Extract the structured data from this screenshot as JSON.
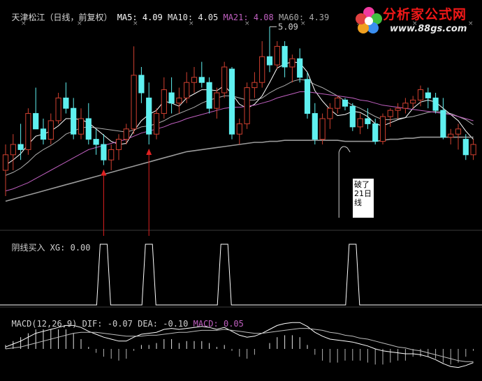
{
  "header": {
    "stock": "天津松江（日线，前复权）",
    "ma5_label": "MA5:",
    "ma5_value": "4.09",
    "ma10_label": "MA10:",
    "ma10_value": "4.05",
    "ma21_label": "MA21:",
    "ma21_value": "4.08",
    "ma60_label": "MA60:",
    "ma60_value": "4.39"
  },
  "indicator": {
    "label": "阴线买入 XG:",
    "value": "0.00"
  },
  "macd": {
    "label": "MACD(12,26,9)",
    "dif_label": "DIF:",
    "dif_value": "-0.07",
    "dea_label": "DEA:",
    "dea_value": "-0.10",
    "macd_label": "MACD:",
    "macd_value": "0.05"
  },
  "annotation": {
    "text": "破了21日线"
  },
  "watermark": {
    "title": "分析家公式网",
    "url": "www.88gs.com"
  },
  "colors": {
    "candle_up": "#d04030",
    "candle_down": "#5ff0f0",
    "ma5": "#ffffff",
    "ma10": "#e8e8e8",
    "ma21": "#c060c0",
    "ma60": "#9a9a9a",
    "xg": "#ffffff",
    "macd_pos": "#ffffff",
    "macd_neg": "#ffffff",
    "arrow": "#e02020"
  },
  "chart_data": [
    {
      "type": "candlestick",
      "title": "天津松江（日线，前复权）",
      "y_range": [
        3.2,
        5.2
      ],
      "max_label": "5.09",
      "candles": [
        {
          "o": 3.7,
          "h": 3.95,
          "l": 3.45,
          "c": 3.85
        },
        {
          "o": 3.85,
          "h": 4.05,
          "l": 3.7,
          "c": 3.95
        },
        {
          "o": 3.95,
          "h": 4.15,
          "l": 3.8,
          "c": 3.9
        },
        {
          "o": 3.9,
          "h": 4.3,
          "l": 3.85,
          "c": 4.25
        },
        {
          "o": 4.25,
          "h": 4.5,
          "l": 4.1,
          "c": 4.1
        },
        {
          "o": 4.1,
          "h": 4.2,
          "l": 3.95,
          "c": 4.0
        },
        {
          "o": 4.0,
          "h": 4.25,
          "l": 3.95,
          "c": 4.18
        },
        {
          "o": 4.18,
          "h": 4.45,
          "l": 4.15,
          "c": 4.4
        },
        {
          "o": 4.4,
          "h": 4.55,
          "l": 4.25,
          "c": 4.3
        },
        {
          "o": 4.3,
          "h": 4.4,
          "l": 4.0,
          "c": 4.05
        },
        {
          "o": 4.05,
          "h": 4.3,
          "l": 4.0,
          "c": 4.2
        },
        {
          "o": 4.2,
          "h": 4.35,
          "l": 3.95,
          "c": 4.0
        },
        {
          "o": 4.0,
          "h": 4.1,
          "l": 3.85,
          "c": 3.95
        },
        {
          "o": 3.95,
          "h": 4.05,
          "l": 3.75,
          "c": 3.8
        },
        {
          "o": 3.8,
          "h": 3.95,
          "l": 3.7,
          "c": 3.9
        },
        {
          "o": 3.9,
          "h": 4.05,
          "l": 3.8,
          "c": 4.0
        },
        {
          "o": 4.0,
          "h": 4.15,
          "l": 3.95,
          "c": 4.1
        },
        {
          "o": 4.1,
          "h": 4.9,
          "l": 4.05,
          "c": 4.62
        },
        {
          "o": 4.62,
          "h": 4.7,
          "l": 4.35,
          "c": 4.45
        },
        {
          "o": 4.4,
          "h": 4.55,
          "l": 3.95,
          "c": 4.05
        },
        {
          "o": 4.05,
          "h": 4.3,
          "l": 4.0,
          "c": 4.25
        },
        {
          "o": 4.25,
          "h": 4.6,
          "l": 4.2,
          "c": 4.48
        },
        {
          "o": 4.45,
          "h": 4.6,
          "l": 4.25,
          "c": 4.35
        },
        {
          "o": 4.35,
          "h": 4.5,
          "l": 4.25,
          "c": 4.4
        },
        {
          "o": 4.4,
          "h": 4.65,
          "l": 4.35,
          "c": 4.55
        },
        {
          "o": 4.55,
          "h": 4.7,
          "l": 4.45,
          "c": 4.6
        },
        {
          "o": 4.6,
          "h": 4.75,
          "l": 4.5,
          "c": 4.55
        },
        {
          "o": 4.55,
          "h": 4.6,
          "l": 4.25,
          "c": 4.3
        },
        {
          "o": 4.3,
          "h": 4.5,
          "l": 4.2,
          "c": 4.45
        },
        {
          "o": 4.45,
          "h": 4.75,
          "l": 4.4,
          "c": 4.7
        },
        {
          "o": 4.68,
          "h": 4.7,
          "l": 4.0,
          "c": 4.05
        },
        {
          "o": 4.05,
          "h": 4.2,
          "l": 3.95,
          "c": 4.15
        },
        {
          "o": 4.15,
          "h": 4.55,
          "l": 4.1,
          "c": 4.5
        },
        {
          "o": 4.5,
          "h": 4.65,
          "l": 4.4,
          "c": 4.55
        },
        {
          "o": 4.55,
          "h": 4.95,
          "l": 4.5,
          "c": 4.8
        },
        {
          "o": 4.8,
          "h": 5.09,
          "l": 4.65,
          "c": 4.72
        },
        {
          "o": 4.72,
          "h": 4.95,
          "l": 4.68,
          "c": 4.9
        },
        {
          "o": 4.9,
          "h": 4.95,
          "l": 4.6,
          "c": 4.7
        },
        {
          "o": 4.7,
          "h": 4.82,
          "l": 4.55,
          "c": 4.78
        },
        {
          "o": 4.78,
          "h": 4.88,
          "l": 4.55,
          "c": 4.6
        },
        {
          "o": 4.58,
          "h": 4.65,
          "l": 4.2,
          "c": 4.25
        },
        {
          "o": 4.25,
          "h": 4.35,
          "l": 3.95,
          "c": 4.0
        },
        {
          "o": 4.0,
          "h": 4.25,
          "l": 3.95,
          "c": 4.2
        },
        {
          "o": 4.2,
          "h": 4.35,
          "l": 4.1,
          "c": 4.3
        },
        {
          "o": 4.3,
          "h": 4.42,
          "l": 4.25,
          "c": 4.4
        },
        {
          "o": 4.38,
          "h": 4.4,
          "l": 4.28,
          "c": 4.32
        },
        {
          "o": 4.32,
          "h": 4.35,
          "l": 4.08,
          "c": 4.12
        },
        {
          "o": 4.12,
          "h": 4.25,
          "l": 4.05,
          "c": 4.2
        },
        {
          "o": 4.2,
          "h": 4.3,
          "l": 4.1,
          "c": 4.15
        },
        {
          "o": 4.15,
          "h": 4.2,
          "l": 3.95,
          "c": 3.98
        },
        {
          "o": 3.98,
          "h": 4.25,
          "l": 3.95,
          "c": 4.22
        },
        {
          "o": 4.22,
          "h": 4.3,
          "l": 4.12,
          "c": 4.28
        },
        {
          "o": 4.28,
          "h": 4.35,
          "l": 4.2,
          "c": 4.3
        },
        {
          "o": 4.3,
          "h": 4.4,
          "l": 4.25,
          "c": 4.35
        },
        {
          "o": 4.35,
          "h": 4.42,
          "l": 4.3,
          "c": 4.38
        },
        {
          "o": 4.38,
          "h": 4.52,
          "l": 4.32,
          "c": 4.48
        },
        {
          "o": 4.45,
          "h": 4.5,
          "l": 4.3,
          "c": 4.4
        },
        {
          "o": 4.4,
          "h": 4.45,
          "l": 4.25,
          "c": 4.28
        },
        {
          "o": 4.28,
          "h": 4.4,
          "l": 4.0,
          "c": 4.02
        },
        {
          "o": 4.02,
          "h": 4.1,
          "l": 3.95,
          "c": 4.05
        },
        {
          "o": 4.05,
          "h": 4.15,
          "l": 3.9,
          "c": 4.1
        },
        {
          "o": 4.0,
          "h": 4.05,
          "l": 3.8,
          "c": 3.85
        },
        {
          "o": 3.85,
          "h": 4.0,
          "l": 3.8,
          "c": 3.95
        }
      ],
      "ma_series": [
        {
          "name": "MA5",
          "values": [
            3.75,
            3.8,
            3.86,
            3.95,
            4.03,
            4.05,
            4.08,
            4.13,
            4.2,
            4.2,
            4.19,
            4.16,
            4.1,
            4.04,
            3.98,
            3.95,
            3.96,
            4.08,
            4.18,
            4.24,
            4.28,
            4.37,
            4.35,
            4.32,
            4.4,
            4.44,
            4.48,
            4.48,
            4.47,
            4.52,
            4.44,
            4.34,
            4.3,
            4.34,
            4.42,
            4.55,
            4.69,
            4.73,
            4.75,
            4.74,
            4.65,
            4.47,
            4.37,
            4.29,
            4.23,
            4.24,
            4.27,
            4.26,
            4.22,
            4.15,
            4.13,
            4.16,
            4.19,
            4.21,
            4.3,
            4.36,
            4.38,
            4.36,
            4.3,
            4.24,
            4.18,
            4.08,
            4.0
          ]
        },
        {
          "name": "MA10",
          "values": [
            3.65,
            3.68,
            3.72,
            3.78,
            3.85,
            3.9,
            3.94,
            3.99,
            4.05,
            4.08,
            4.11,
            4.12,
            4.11,
            4.1,
            4.09,
            4.08,
            4.07,
            4.09,
            4.12,
            4.13,
            4.15,
            4.18,
            4.22,
            4.25,
            4.28,
            4.31,
            4.35,
            4.38,
            4.4,
            4.42,
            4.42,
            4.4,
            4.38,
            4.38,
            4.4,
            4.45,
            4.49,
            4.52,
            4.56,
            4.58,
            4.57,
            4.53,
            4.5,
            4.46,
            4.42,
            4.37,
            4.33,
            4.3,
            4.26,
            4.22,
            4.19,
            4.19,
            4.2,
            4.21,
            4.22,
            4.24,
            4.26,
            4.27,
            4.26,
            4.25,
            4.22,
            4.19,
            4.14
          ]
        },
        {
          "name": "MA21",
          "values": [
            3.5,
            3.52,
            3.55,
            3.58,
            3.62,
            3.66,
            3.7,
            3.74,
            3.78,
            3.82,
            3.86,
            3.9,
            3.92,
            3.94,
            3.96,
            3.98,
            4.0,
            4.03,
            4.06,
            4.08,
            4.1,
            4.12,
            4.15,
            4.17,
            4.2,
            4.22,
            4.24,
            4.26,
            4.28,
            4.3,
            4.31,
            4.31,
            4.32,
            4.33,
            4.35,
            4.37,
            4.4,
            4.42,
            4.44,
            4.46,
            4.46,
            4.45,
            4.44,
            4.43,
            4.42,
            4.41,
            4.4,
            4.38,
            4.37,
            4.35,
            4.33,
            4.32,
            4.31,
            4.3,
            4.29,
            4.28,
            4.27,
            4.26,
            4.25,
            4.24,
            4.22,
            4.2,
            4.18
          ]
        },
        {
          "name": "MA60",
          "values": [
            3.4,
            3.42,
            3.44,
            3.46,
            3.48,
            3.5,
            3.52,
            3.54,
            3.56,
            3.58,
            3.6,
            3.62,
            3.64,
            3.66,
            3.68,
            3.7,
            3.72,
            3.74,
            3.76,
            3.78,
            3.8,
            3.82,
            3.84,
            3.86,
            3.88,
            3.89,
            3.9,
            3.91,
            3.92,
            3.93,
            3.94,
            3.95,
            3.96,
            3.97,
            3.97,
            3.98,
            3.98,
            3.99,
            3.99,
            3.99,
            3.99,
            3.99,
            3.99,
            3.99,
            3.99,
            3.98,
            3.98,
            3.98,
            3.98,
            3.98,
            3.99,
            4.0,
            4.0,
            4.01,
            4.01,
            4.02,
            4.02,
            4.02,
            4.02,
            4.02,
            4.02,
            4.02,
            4.02
          ]
        }
      ]
    },
    {
      "type": "line",
      "title": "阴线买入 XG",
      "y_range": [
        0,
        1
      ],
      "signals_at_candle": [
        13,
        19,
        29,
        46
      ],
      "arrows_at_candle": [
        13,
        19
      ]
    },
    {
      "type": "bar",
      "title": "MACD(12,26,9)",
      "y_range": [
        -0.3,
        0.3
      ],
      "dif": [
        0.02,
        0.05,
        0.08,
        0.12,
        0.16,
        0.18,
        0.2,
        0.22,
        0.24,
        0.24,
        0.22,
        0.18,
        0.15,
        0.12,
        0.1,
        0.08,
        0.08,
        0.12,
        0.15,
        0.16,
        0.17,
        0.2,
        0.21,
        0.2,
        0.21,
        0.22,
        0.23,
        0.22,
        0.2,
        0.22,
        0.18,
        0.14,
        0.12,
        0.13,
        0.16,
        0.2,
        0.24,
        0.26,
        0.27,
        0.27,
        0.23,
        0.17,
        0.13,
        0.1,
        0.09,
        0.08,
        0.07,
        0.05,
        0.03,
        0.0,
        -0.02,
        -0.03,
        -0.04,
        -0.05,
        -0.05,
        -0.06,
        -0.08,
        -0.11,
        -0.15,
        -0.18,
        -0.19,
        -0.17,
        -0.14
      ],
      "dea": [
        0.0,
        0.01,
        0.02,
        0.04,
        0.06,
        0.08,
        0.1,
        0.12,
        0.14,
        0.16,
        0.17,
        0.17,
        0.17,
        0.16,
        0.15,
        0.14,
        0.13,
        0.13,
        0.13,
        0.14,
        0.14,
        0.15,
        0.16,
        0.17,
        0.17,
        0.18,
        0.19,
        0.19,
        0.19,
        0.2,
        0.19,
        0.18,
        0.17,
        0.16,
        0.16,
        0.17,
        0.18,
        0.19,
        0.2,
        0.21,
        0.21,
        0.2,
        0.19,
        0.17,
        0.16,
        0.14,
        0.13,
        0.11,
        0.1,
        0.08,
        0.06,
        0.04,
        0.02,
        0.01,
        -0.01,
        -0.02,
        -0.04,
        -0.06,
        -0.08,
        -0.1,
        -0.12,
        -0.13,
        -0.13
      ],
      "macd": [
        0.04,
        0.08,
        0.12,
        0.16,
        0.2,
        0.2,
        0.2,
        0.2,
        0.2,
        0.16,
        0.1,
        0.02,
        -0.04,
        -0.08,
        -0.1,
        -0.12,
        -0.1,
        -0.02,
        0.04,
        0.04,
        0.06,
        0.1,
        0.1,
        0.06,
        0.08,
        0.08,
        0.08,
        0.06,
        0.02,
        0.04,
        -0.02,
        -0.08,
        -0.1,
        -0.06,
        0.0,
        0.06,
        0.12,
        0.14,
        0.14,
        0.12,
        0.04,
        -0.06,
        -0.12,
        -0.14,
        -0.14,
        -0.12,
        -0.12,
        -0.12,
        -0.14,
        -0.16,
        -0.16,
        -0.14,
        -0.12,
        -0.12,
        -0.08,
        -0.08,
        -0.08,
        -0.1,
        -0.14,
        -0.16,
        -0.14,
        -0.08,
        -0.02
      ]
    }
  ]
}
